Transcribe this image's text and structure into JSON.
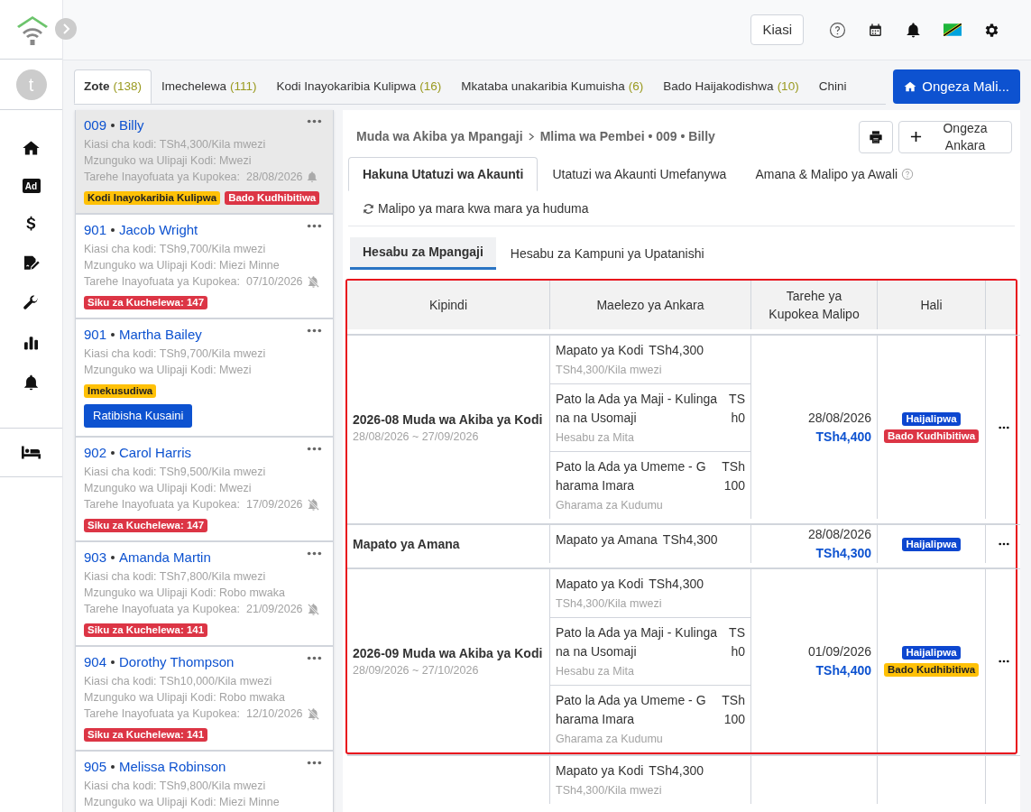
{
  "sidebar": {
    "avatar": "t",
    "nav": [
      {
        "kind": "home"
      },
      {
        "kind": "ad",
        "text": "Ad"
      },
      {
        "kind": "dollar"
      },
      {
        "kind": "contract"
      },
      {
        "kind": "wrench"
      },
      {
        "kind": "chart"
      },
      {
        "kind": "bell"
      }
    ],
    "bottom_nav": [
      {
        "kind": "bed"
      }
    ]
  },
  "topbar": {
    "currency_button": "Kiasi"
  },
  "filter_tabs": [
    {
      "label": "Zote",
      "count": "(138)",
      "selected": true
    },
    {
      "label": "Imechelewa",
      "count": "(111)",
      "selected": false
    },
    {
      "label": "Kodi Inayokaribia Kulipwa",
      "count": "(16)",
      "selected": false
    },
    {
      "label": "Mkataba unakaribia Kumuisha",
      "count": "(6)",
      "selected": false
    },
    {
      "label": "Bado Haijakodishwa",
      "count": "(10)",
      "selected": false
    },
    {
      "label": "Chini",
      "selected": false
    }
  ],
  "add_property_button": "Ongeza Mali...",
  "tenants": [
    {
      "unit": "009",
      "name": "Billy",
      "selected": true,
      "rent": "Kiasi cha kodi: TSh4,300/Kila mwezi",
      "cycle": "Mzunguko wa Ulipaji Kodi: Mwezi",
      "next_date": "Tarehe Inayofuata ya Kupokea:  28/08/2026",
      "reminder": true,
      "tags": [
        {
          "text": "Kodi Inayokaribia Kulipwa",
          "color": "#ffc107"
        },
        {
          "text": "Bado Kudhibitiwa",
          "color": "#dc3545"
        }
      ]
    },
    {
      "unit": "901",
      "name": "Jacob Wright",
      "selected": false,
      "rent": "Kiasi cha kodi: TSh9,700/Kila mwezi",
      "cycle": "Mzunguko wa Ulipaji Kodi: Miezi Minne",
      "next_date": "Tarehe Inayofuata ya Kupokea:  07/10/2026",
      "reminder": false,
      "tags": [
        {
          "text": "Siku za Kuchelewa: 147",
          "color": "#dc3545"
        }
      ]
    },
    {
      "unit": "901",
      "name": "Martha Bailey",
      "selected": false,
      "rent": "Kiasi cha kodi: TSh9,700/Kila mwezi",
      "cycle": "Mzunguko wa Ulipaji Kodi: Mwezi",
      "tags": [
        {
          "text": "Imekusudiwa",
          "color": "#ffc107"
        }
      ],
      "action": "Ratibisha Kusaini"
    },
    {
      "unit": "902",
      "name": "Carol Harris",
      "selected": false,
      "rent": "Kiasi cha kodi: TSh9,500/Kila mwezi",
      "cycle": "Mzunguko wa Ulipaji Kodi: Mwezi",
      "next_date": "Tarehe Inayofuata ya Kupokea:  17/09/2026",
      "reminder": false,
      "tags": [
        {
          "text": "Siku za Kuchelewa: 147",
          "color": "#dc3545"
        }
      ]
    },
    {
      "unit": "903",
      "name": "Amanda Martin",
      "selected": false,
      "rent": "Kiasi cha kodi: TSh7,800/Kila mwezi",
      "cycle": "Mzunguko wa Ulipaji Kodi: Robo mwaka",
      "next_date": "Tarehe Inayofuata ya Kupokea:  21/09/2026",
      "reminder": false,
      "tags": [
        {
          "text": "Siku za Kuchelewa: 141",
          "color": "#dc3545"
        }
      ]
    },
    {
      "unit": "904",
      "name": "Dorothy Thompson",
      "selected": false,
      "rent": "Kiasi cha kodi: TSh10,000/Kila mwezi",
      "cycle": "Mzunguko wa Ulipaji Kodi: Robo mwaka",
      "next_date": "Tarehe Inayofuata ya Kupokea:  12/10/2026",
      "reminder": false,
      "tags": [
        {
          "text": "Siku za Kuchelewa: 141",
          "color": "#dc3545"
        }
      ]
    },
    {
      "unit": "905",
      "name": "Melissa Robinson",
      "selected": false,
      "rent": "Kiasi cha kodi: TSh9,800/Kila mwezi",
      "cycle": "Mzunguko wa Ulipaji Kodi: Miezi Minne"
    }
  ],
  "detail": {
    "breadcrumb": [
      "Muda wa Akiba ya Mpangaji",
      "Mlima wa Pembei • 009 • Billy"
    ],
    "add_invoice_button": "Ongeza Ankara",
    "tabs": [
      {
        "label": "Hakuna Utatuzi wa Akaunti",
        "selected": true
      },
      {
        "label": "Utatuzi wa Akaunti Umefanywa",
        "selected": false
      },
      {
        "label": "Amana & Malipo ya Awali",
        "selected": false,
        "help": true
      },
      {
        "label": "Malipo ya mara kwa mara ya huduma",
        "selected": false,
        "refresh": true
      }
    ],
    "subtabs": [
      {
        "label": "Hesabu za Mpangaji",
        "selected": true
      },
      {
        "label": "Hesabu za Kampuni ya Upatanishi",
        "selected": false
      }
    ],
    "table": {
      "columns": [
        "Kipindi",
        "Maelezo ya Ankara",
        "Tarehe ya Kupokea Malipo",
        "Hali"
      ],
      "groups": [
        {
          "highlighted": true,
          "period": "2026-08 Muda wa Akiba ya Kodi",
          "range": "28/08/2026 ~ 27/09/2026",
          "items": [
            {
              "label": "Mapato ya Kodi",
              "amount": "TSh4,300",
              "note": "TSh4,300/Kila mwezi"
            },
            {
              "label": "Pato la Ada ya Maji - Kulingana na Usomaji",
              "amount": "TSh0",
              "note": "Hesabu za Mita"
            },
            {
              "label": "Pato la Ada ya Umeme - Gharama Imara",
              "amount": "TSh100",
              "note": "Gharama za Kudumu"
            }
          ],
          "date": "28/08/2026",
          "total": "TSh4,400",
          "statuses": [
            {
              "text": "Haijalipwa",
              "color": "#0d47d0"
            },
            {
              "text": "Bado Kudhibitiwa",
              "color": "#dc3545"
            }
          ]
        },
        {
          "highlighted": true,
          "period": "Mapato ya Amana",
          "items": [
            {
              "label": "Mapato ya Amana",
              "amount": "TSh4,300"
            }
          ],
          "date": "28/08/2026",
          "total": "TSh4,300",
          "statuses": [
            {
              "text": "Haijalipwa",
              "color": "#0d47d0"
            }
          ]
        },
        {
          "highlighted": true,
          "period": "2026-09 Muda wa Akiba ya Kodi",
          "range": "28/09/2026 ~ 27/10/2026",
          "items": [
            {
              "label": "Mapato ya Kodi",
              "amount": "TSh4,300",
              "note": "TSh4,300/Kila mwezi"
            },
            {
              "label": "Pato la Ada ya Maji - Kulingana na Usomaji",
              "amount": "TSh0",
              "note": "Hesabu za Mita"
            },
            {
              "label": "Pato la Ada ya Umeme - Gharama Imara",
              "amount": "TSh100",
              "note": "Gharama za Kudumu"
            }
          ],
          "date": "01/09/2026",
          "total": "TSh4,400",
          "statuses": [
            {
              "text": "Haijalipwa",
              "color": "#0d47d0"
            },
            {
              "text": "Bado Kudhibitiwa",
              "color": "#ffc107"
            }
          ]
        },
        {
          "highlighted": false,
          "items": [
            {
              "label": "Mapato ya Kodi",
              "amount": "TSh4,300",
              "note": "TSh4,300/Kila mwezi"
            }
          ]
        }
      ]
    }
  }
}
